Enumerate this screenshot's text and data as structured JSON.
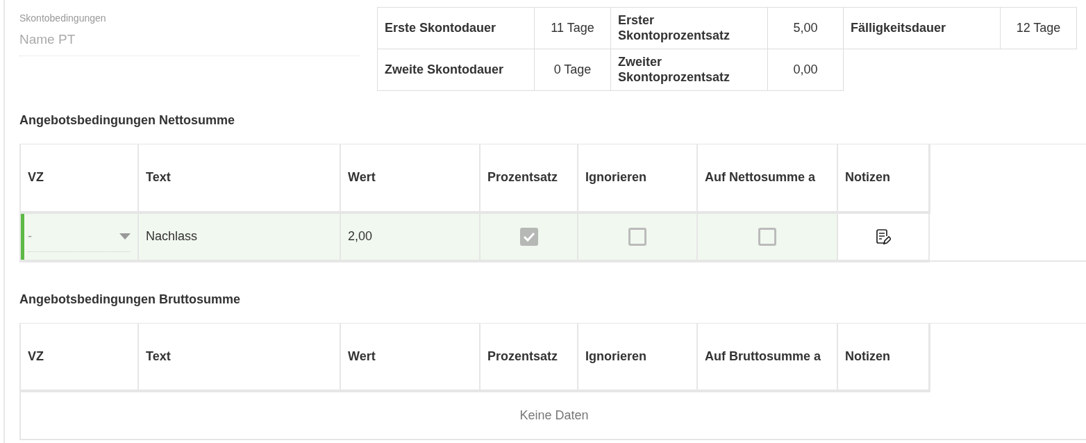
{
  "skonto": {
    "label": "Skontobedingungen",
    "placeholder": "Name PT"
  },
  "terms": [
    [
      {
        "label": "Erste Skontodauer",
        "value": "11 Tage"
      },
      {
        "label": "Erster Skontoprozentsatz",
        "value": "5,00"
      },
      {
        "label": "Fälligkeitsdauer",
        "value": "12 Tage"
      }
    ],
    [
      {
        "label": "Zweite Skontodauer",
        "value": "0 Tage"
      },
      {
        "label": "Zweiter Skontoprozentsatz",
        "value": "0,00"
      }
    ]
  ],
  "sections": [
    {
      "title": "Angebotsbedingungen Nettosumme",
      "columns": [
        "VZ",
        "Text",
        "Wert",
        "Prozentsatz",
        "Ignorieren",
        "Auf Nettosumme a",
        "Notizen"
      ],
      "rows": [
        {
          "selected": true,
          "vz": "-",
          "text": "Nachlass",
          "value": "2,00",
          "percent": true,
          "ignore": false,
          "apply": false
        }
      ]
    },
    {
      "title": "Angebotsbedingungen Bruttosumme",
      "columns": [
        "VZ",
        "Text",
        "Wert",
        "Prozentsatz",
        "Ignorieren",
        "Auf Bruttosumme a",
        "Notizen"
      ],
      "empty_text": "Keine Daten"
    }
  ]
}
